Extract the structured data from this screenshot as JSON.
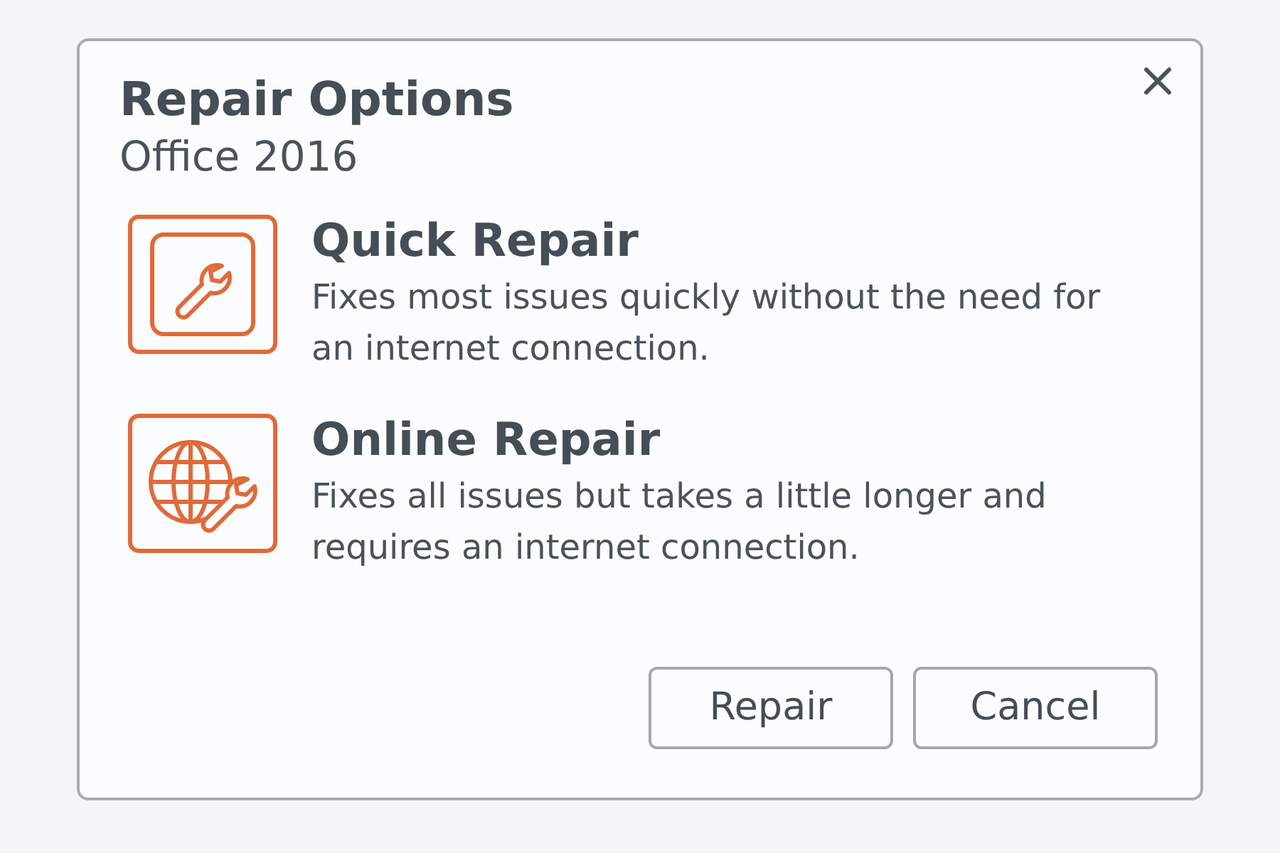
{
  "dialog": {
    "title": "Repair Options",
    "subtitle": "Office 2016"
  },
  "options": [
    {
      "kind": "quick",
      "title": "Quick Repair",
      "description": "Fixes most issues quickly without the need for an internet connection."
    },
    {
      "kind": "online",
      "title": "Online Repair",
      "description": "Fixes all issues but takes a little longer and requires an internet connection."
    }
  ],
  "buttons": [
    "Repair",
    "Cancel"
  ]
}
